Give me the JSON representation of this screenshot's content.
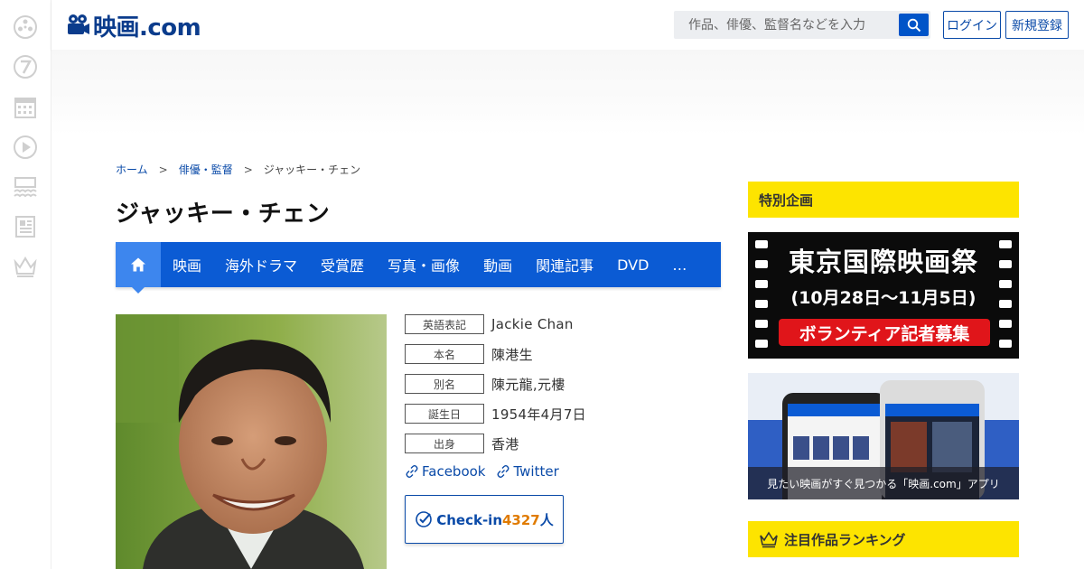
{
  "header": {
    "logo_text": "映画.com",
    "search_placeholder": "作品、俳優、監督名などを入力",
    "login_label": "ログイン",
    "register_label": "新規登録"
  },
  "rail_icons": [
    "film-reel-icon",
    "seven-icon",
    "calendar-icon",
    "play-icon",
    "theater-icon",
    "news-icon",
    "crown-icon"
  ],
  "breadcrumb": {
    "home": "ホーム",
    "sep": ">",
    "category": "俳優・監督",
    "current": "ジャッキー・チェン"
  },
  "page_title": "ジャッキー・チェン",
  "tabs": [
    "映画",
    "海外ドラマ",
    "受賞歴",
    "写真・画像",
    "動画",
    "関連記事",
    "DVD",
    "…"
  ],
  "profile": {
    "rows": [
      {
        "label": "英語表記",
        "value": "Jackie Chan"
      },
      {
        "label": "本名",
        "value": "陳港生"
      },
      {
        "label": "別名",
        "value": "陳元龍,元樓"
      },
      {
        "label": "誕生日",
        "value": "1954年4月7日"
      },
      {
        "label": "出身",
        "value": "香港"
      }
    ],
    "facebook": "Facebook",
    "twitter": "Twitter",
    "checkin_label": "Check-in",
    "checkin_count": "4327",
    "checkin_unit": "人"
  },
  "sidebar": {
    "special_heading": "特別企画",
    "banner1_title": "東京国際映画祭",
    "banner1_dates": "(10月28日〜11月5日)",
    "banner1_cta": "ボランティア記者募集",
    "banner2_caption": "見たい映画がすぐ見つかる「映画.com」アプリ",
    "ranking_heading": "注目作品ランキング"
  },
  "colors": {
    "brand_blue": "#0b5bd4",
    "link_blue": "#0a4aa8",
    "accent_yellow": "#fde400",
    "checkin_orange": "#e07b00",
    "promo_red": "#e0151a"
  }
}
